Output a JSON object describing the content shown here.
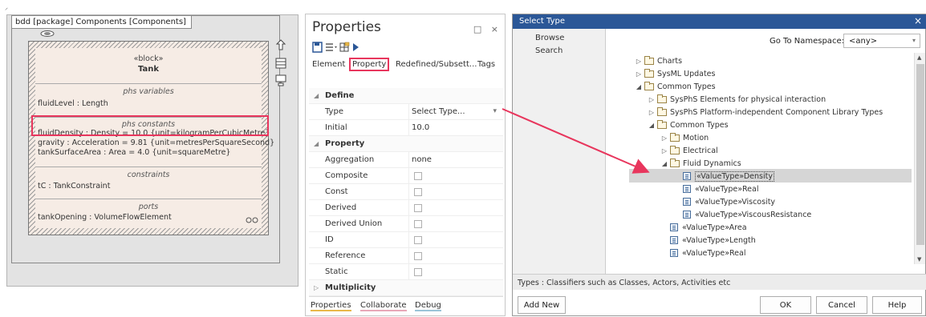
{
  "diagram": {
    "tab_label": "bdd [package] Components [Components]",
    "block": {
      "stereotype": "«block»",
      "name": "Tank",
      "compartments": [
        {
          "heading": "phs variables",
          "rows": [
            "fluidLevel : Length"
          ]
        },
        {
          "heading": "phs constants",
          "rows": [
            "fluidDensity : Density = 10.0 {unit=kilogramPerCubicMetre}",
            "gravity : Acceleration = 9.81 {unit=metresPerSquareSecond}",
            "tankSurfaceArea : Area = 4.0 {unit=squareMetre}"
          ]
        },
        {
          "heading": "constraints",
          "rows": [
            "tC : TankConstraint"
          ]
        },
        {
          "heading": "ports",
          "rows": [
            "tankOpening : VolumeFlowElement"
          ]
        }
      ]
    },
    "highlight_color": "#e8365d"
  },
  "properties": {
    "title": "Properties",
    "tabs": [
      "Element",
      "Property",
      "Redefined/Subsett...",
      "Tags"
    ],
    "active_tab": "Property",
    "sections": [
      {
        "name": "Define",
        "rows": [
          {
            "label": "Type",
            "value": "Select Type..."
          },
          {
            "label": "Initial",
            "value": "10.0"
          }
        ]
      },
      {
        "name": "Property",
        "rows": [
          {
            "label": "Aggregation",
            "value": "none"
          },
          {
            "label": "Composite",
            "value": ""
          },
          {
            "label": "Const",
            "value": ""
          },
          {
            "label": "Derived",
            "value": ""
          },
          {
            "label": "Derived Union",
            "value": ""
          },
          {
            "label": "ID",
            "value": ""
          },
          {
            "label": "Reference",
            "value": ""
          },
          {
            "label": "Static",
            "value": ""
          }
        ]
      },
      {
        "name": "Multiplicity",
        "rows": []
      }
    ],
    "bottom_tabs": [
      "Properties",
      "Collaborate",
      "Debug"
    ]
  },
  "dialog": {
    "title": "Select Type",
    "close_glyph": "×",
    "left_nav": [
      "Browse",
      "Search"
    ],
    "namespace_label": "Go To Namespace:",
    "namespace_value": "<any>",
    "tree": [
      {
        "label": "Charts",
        "kind": "folder",
        "arrow": "▷"
      },
      {
        "label": "SysML Updates",
        "kind": "folder",
        "arrow": "▷"
      },
      {
        "label": "Common Types",
        "kind": "folder",
        "arrow": "◢"
      },
      {
        "label": "SysPhS Elements for physical interaction",
        "kind": "folder",
        "arrow": "▷"
      },
      {
        "label": "SysPhS Platform-independent Component Library Types",
        "kind": "folder",
        "arrow": "▷"
      },
      {
        "label": "Common Types",
        "kind": "folder",
        "arrow": "◢"
      },
      {
        "label": "Motion",
        "kind": "folder",
        "arrow": "▷"
      },
      {
        "label": "Electrical",
        "kind": "folder",
        "arrow": "▷"
      },
      {
        "label": "Fluid Dynamics",
        "kind": "folder",
        "arrow": "◢"
      },
      {
        "label": "«ValueType»Density",
        "kind": "valuetype",
        "arrow": ""
      },
      {
        "label": "«ValueType»Real",
        "kind": "valuetype",
        "arrow": ""
      },
      {
        "label": "«ValueType»Viscosity",
        "kind": "valuetype",
        "arrow": ""
      },
      {
        "label": "«ValueType»ViscousResistance",
        "kind": "valuetype",
        "arrow": ""
      },
      {
        "label": "«ValueType»Area",
        "kind": "valuetype",
        "arrow": ""
      },
      {
        "label": "«ValueType»Length",
        "kind": "valuetype",
        "arrow": ""
      },
      {
        "label": "«ValueType»Real",
        "kind": "valuetype",
        "arrow": ""
      }
    ],
    "selected": "«ValueType»Density",
    "description": "Types : Classifiers such as Classes, Actors, Activities etc",
    "buttons": {
      "add_new": "Add New",
      "ok": "OK",
      "cancel": "Cancel",
      "help": "Help"
    },
    "titlebar_color": "#2b5797"
  }
}
